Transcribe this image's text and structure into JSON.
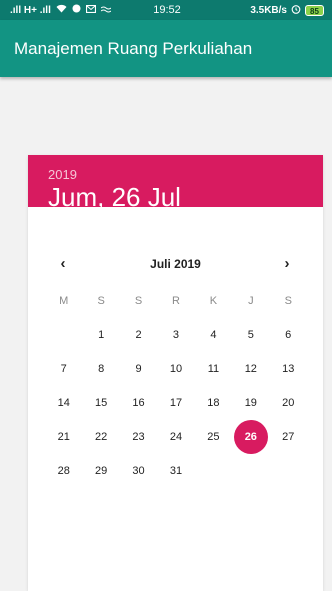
{
  "status_bar": {
    "network_left": ".ıll H+ .ıll",
    "icons_left": [
      "wifi-icon",
      "notification-icon",
      "message-icon",
      "wave-icon"
    ],
    "time": "19:52",
    "speed": "3.5KB/s",
    "battery": "85"
  },
  "app_bar": {
    "title": "Manajemen Ruang Perkuliahan"
  },
  "date_picker": {
    "header_year": "2019",
    "header_date": "Jum, 26 Jul",
    "month_title": "Juli 2019",
    "prev_label": "‹",
    "next_label": "›",
    "weekdays": [
      "M",
      "S",
      "S",
      "R",
      "K",
      "J",
      "S"
    ],
    "days": [
      "",
      "1",
      "2",
      "3",
      "4",
      "5",
      "6",
      "7",
      "8",
      "9",
      "10",
      "11",
      "12",
      "13",
      "14",
      "15",
      "16",
      "17",
      "18",
      "19",
      "20",
      "21",
      "22",
      "23",
      "24",
      "25",
      "26",
      "27",
      "28",
      "29",
      "30",
      "31",
      "",
      "",
      ""
    ],
    "selected_day": "26"
  },
  "colors": {
    "status_bar": "#0d7a6e",
    "app_bar": "#129483",
    "accent": "#d81b60"
  }
}
